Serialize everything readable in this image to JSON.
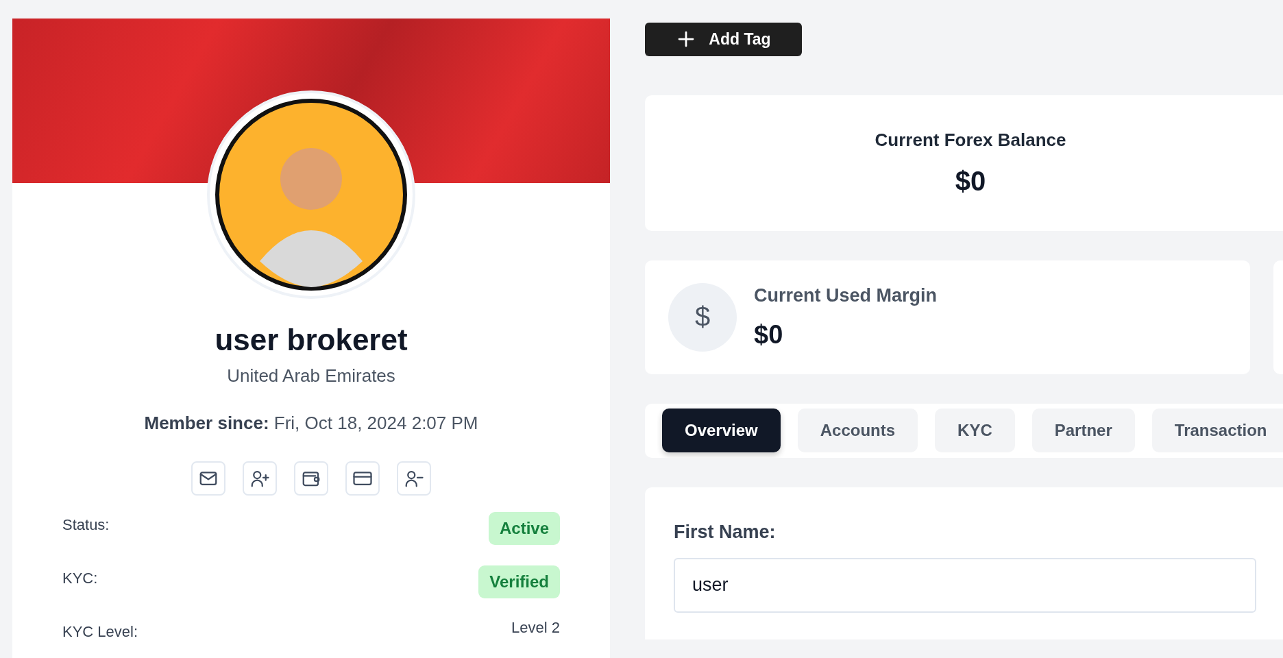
{
  "profile": {
    "name": "user brokeret",
    "country": "United Arab Emirates",
    "member_since_label": "Member since:",
    "member_since": "Fri, Oct 18, 2024 2:07 PM",
    "actions": [
      {
        "kind": "mail"
      },
      {
        "kind": "user-plus"
      },
      {
        "kind": "wallet"
      },
      {
        "kind": "card"
      },
      {
        "kind": "user-minus"
      }
    ],
    "details": [
      {
        "label": "Status:",
        "value": "Active",
        "kind": "badge"
      },
      {
        "label": "KYC:",
        "value": "Verified",
        "kind": "badge"
      },
      {
        "label": "KYC Level:",
        "value": "Level 2",
        "kind": "text"
      }
    ]
  },
  "add_tag": {
    "label": "Add Tag"
  },
  "balance_card": {
    "title": "Current Forex Balance",
    "value": "$0"
  },
  "margin_card": {
    "title": "Current Used Margin",
    "value": "$0",
    "icon": "$"
  },
  "tabs": [
    {
      "label": "Overview",
      "selected": true
    },
    {
      "label": "Accounts",
      "selected": false
    },
    {
      "label": "KYC",
      "selected": false
    },
    {
      "label": "Partner",
      "selected": false
    },
    {
      "label": "Transaction",
      "selected": false
    }
  ],
  "form": {
    "fields": [
      {
        "label": "First Name:",
        "value": "user"
      }
    ]
  }
}
